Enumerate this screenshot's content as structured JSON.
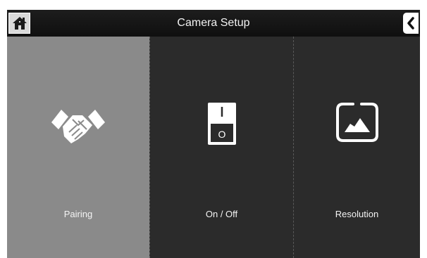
{
  "header": {
    "title": "Camera Setup",
    "home_icon": "home-icon",
    "back_icon": "back-chevron-icon"
  },
  "tiles": [
    {
      "label": "Pairing",
      "icon": "handshake-icon",
      "selected": true
    },
    {
      "label": "On / Off",
      "icon": "power-switch-icon",
      "selected": false,
      "switch_on_mark": "I",
      "switch_off_mark": "O"
    },
    {
      "label": "Resolution",
      "icon": "resolution-picture-icon",
      "selected": false
    }
  ],
  "colors": {
    "background": "#2b2b2b",
    "header": "#141414",
    "selected_tile": "#8a8a8a",
    "text": "#f4f4f4"
  }
}
